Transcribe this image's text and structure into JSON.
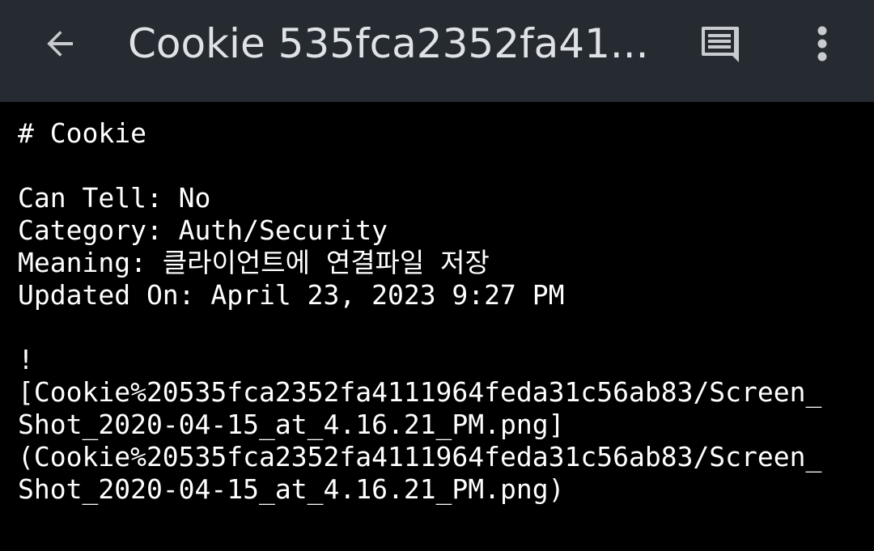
{
  "toolbar": {
    "title": "Cookie 535fca2352fa41...",
    "back_icon": "arrow-left-icon",
    "comment_icon": "comment-icon",
    "more_icon": "more-vert-icon",
    "background": "#252b31",
    "title_color": "#dfe3e7"
  },
  "content": {
    "heading": "# Cookie",
    "can_tell": "Can Tell: No",
    "category": "Category: Auth/Security",
    "meaning": "Meaning: 클라이언트에 연결파일 저장",
    "updated_on": "Updated On: April 23, 2023 9:27 PM",
    "image_bang": "!",
    "image_alt_line1": "[Cookie%20535fca2352fa4111964feda31c56ab83/Screen_",
    "image_alt_line2": "Shot_2020-04-15_at_4.16.21_PM.png]",
    "image_src_line1": "(Cookie%20535fca2352fa4111964feda31c56ab83/Screen_",
    "image_src_line2": "Shot_2020-04-15_at_4.16.21_PM.png)"
  }
}
